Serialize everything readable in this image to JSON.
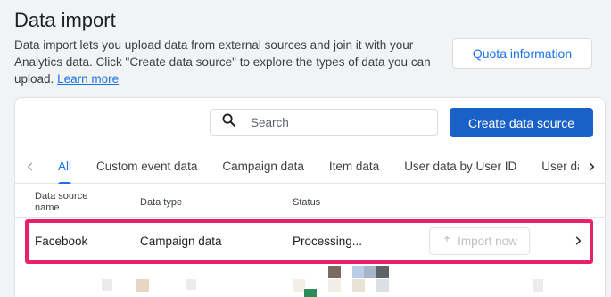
{
  "header": {
    "title": "Data import",
    "description": "Data import lets you upload data from external sources and join it with your Analytics data. Click \"Create data source\" to explore the types of data you can upload.",
    "learn_more": "Learn more",
    "quota_button": "Quota information"
  },
  "toolbar": {
    "search_placeholder": "Search",
    "create_button": "Create data source"
  },
  "tabs": [
    {
      "label": "All",
      "active": true
    },
    {
      "label": "Custom event data"
    },
    {
      "label": "Campaign data"
    },
    {
      "label": "Item data"
    },
    {
      "label": "User data by User ID"
    },
    {
      "label": "User data by Client ID"
    }
  ],
  "table": {
    "headers": [
      "Data source name",
      "Data type",
      "Status"
    ],
    "rows": [
      {
        "name": "Facebook",
        "type": "Campaign data",
        "status": "Processing...",
        "action": "Import now"
      }
    ]
  },
  "colors": {
    "accent": "#1a73e8",
    "primary_button": "#1a61c7",
    "highlight": "#e8226a"
  },
  "icons": {
    "search": "search-icon",
    "tab_left": "chevron-left-icon",
    "tab_right": "chevron-right-icon",
    "upload": "upload-icon",
    "row_open": "chevron-right-icon"
  }
}
